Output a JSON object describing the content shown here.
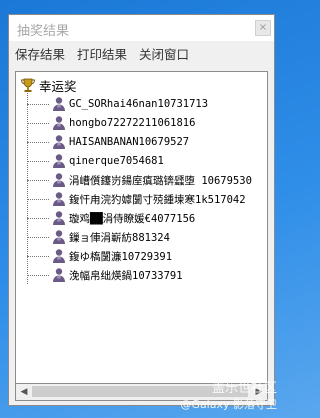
{
  "window": {
    "title": "抽奖结果",
    "close_label": "×"
  },
  "menu": {
    "save": "保存结果",
    "print": "打印结果",
    "close": "关闭窗口"
  },
  "tree": {
    "root_label": "幸运奖",
    "root_icon": "trophy-icon",
    "item_icon": "person-icon",
    "items": [
      "GC_SORhai46nan10731713",
      "hongbo72272211061816",
      "HAISANBANAN10679527",
      "qinerque7054681",
      "涓嶆儨鑳岃鍚庢瘨璐锛瓥堕 10679530",
      "鍑忓甪浣犳嫭闅寸殑鍾堜寒1k517042",
      "璇鸡██涓侍瞭媛€4077156",
      "鏁ョ俥涓嶄紡881324",
      "鍑ゆ槗闅濂10729391",
      "浼幅帛绌煐鍋10733791"
    ]
  },
  "scrollbar": {
    "left_arrow": "◀",
    "right_arrow": "▶"
  },
  "watermarks": {
    "site": "盖乐世社区",
    "credit": "@Galaxy 影落守卫"
  },
  "colors": {
    "desktop": "#2f8ee8",
    "window_bg": "#f0f0f0",
    "title_text": "#a8a8a8",
    "person_icon": "#6b5a86"
  }
}
